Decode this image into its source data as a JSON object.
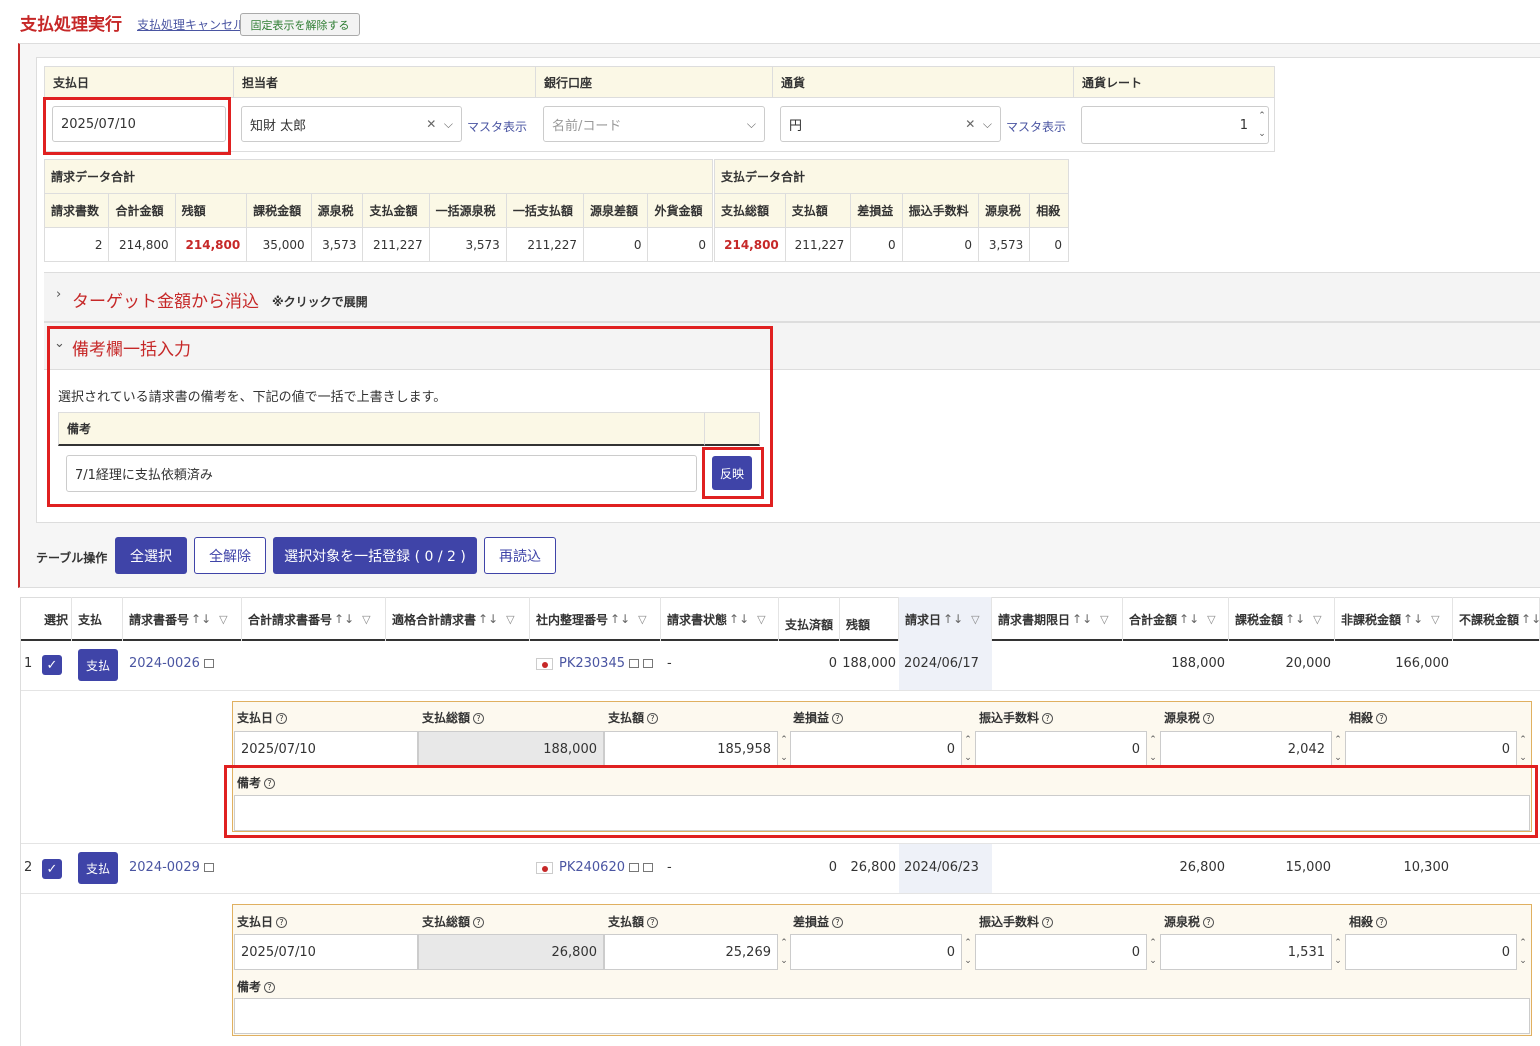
{
  "header": {
    "title": "支払処理実行",
    "cancel_link": "支払処理キャンセル",
    "unpin_button": "固定表示を解除する"
  },
  "form": {
    "payment_date_label": "支払日",
    "payment_date": "2025/07/10",
    "person_label": "担当者",
    "person_value": "知財 太郎",
    "master_link": "マスタ表示",
    "bank_label": "銀行口座",
    "bank_placeholder": "名前/コード",
    "currency_label": "通貨",
    "currency_value": "円",
    "rate_label": "通貨レート",
    "rate_value": "1"
  },
  "invoice_summary": {
    "title": "請求データ合計",
    "headers": [
      "請求書数",
      "合計金額",
      "残額",
      "課税金額",
      "源泉税",
      "支払金額",
      "一括源泉税",
      "一括支払額",
      "源泉差額",
      "外貨金額"
    ],
    "values": [
      "2",
      "214,800",
      "214,800",
      "35,000",
      "3,573",
      "211,227",
      "3,573",
      "211,227",
      "0",
      "0"
    ]
  },
  "payment_summary": {
    "title": "支払データ合計",
    "headers": [
      "支払総額",
      "支払額",
      "差損益",
      "振込手数料",
      "源泉税",
      "相殺"
    ],
    "values": [
      "214,800",
      "211,227",
      "0",
      "0",
      "3,573",
      "0"
    ]
  },
  "target_section": {
    "title": "ターゲット金額から消込",
    "hint": "※クリックで展開"
  },
  "memo_section": {
    "title": "備考欄一括入力",
    "description": "選択されている請求書の備考を、下記の値で一括で上書きします。",
    "column_label": "備考",
    "value": "7/1経理に支払依頼済み",
    "apply_button": "反映"
  },
  "table_ops": {
    "label": "テーブル操作",
    "select_all": "全選択",
    "deselect_all": "全解除",
    "bulk_register": "選択対象を一括登録 ( 0 / 2 )",
    "reload": "再読込"
  },
  "table": {
    "headers": {
      "select": "選択",
      "pay": "支払",
      "invoice_no": "請求書番号",
      "total_invoice_no": "合計請求書番号",
      "qualified_invoice": "適格合計請求書",
      "internal_no": "社内整理番号",
      "status": "請求書状態",
      "paid": "支払済額",
      "remaining": "残額",
      "invoice_date": "請求日",
      "due_date": "請求書期限日",
      "total": "合計金額",
      "taxable": "課税金額",
      "nontaxable": "非課税金額",
      "untaxed": "不課税金額"
    },
    "rows": [
      {
        "num": "1",
        "pay_button": "支払",
        "invoice_no": "2024-0026",
        "internal_no": "PK230345",
        "status": "-",
        "paid": "0",
        "remaining": "188,000",
        "invoice_date": "2024/06/17",
        "total": "188,000",
        "taxable": "20,000",
        "nontaxable": "166,000",
        "detail": {
          "labels": [
            "支払日",
            "支払総額",
            "支払額",
            "差損益",
            "振込手数料",
            "源泉税",
            "相殺"
          ],
          "values": [
            "2025/07/10",
            "188,000",
            "185,958",
            "0",
            "0",
            "2,042",
            "0"
          ],
          "memo_label": "備考",
          "memo": ""
        }
      },
      {
        "num": "2",
        "pay_button": "支払",
        "invoice_no": "2024-0029",
        "internal_no": "PK240620",
        "status": "-",
        "paid": "0",
        "remaining": "26,800",
        "invoice_date": "2024/06/23",
        "total": "26,800",
        "taxable": "15,000",
        "nontaxable": "10,300",
        "detail": {
          "labels": [
            "支払日",
            "支払総額",
            "支払額",
            "差損益",
            "振込手数料",
            "源泉税",
            "相殺"
          ],
          "values": [
            "2025/07/10",
            "26,800",
            "25,269",
            "0",
            "0",
            "1,531",
            "0"
          ],
          "memo_label": "備考",
          "memo": ""
        }
      }
    ]
  },
  "colors": {
    "accent": "#3f44a8",
    "title_red": "#c62828",
    "highlight_red": "#e02020",
    "header_bg": "#fbf8e6"
  }
}
